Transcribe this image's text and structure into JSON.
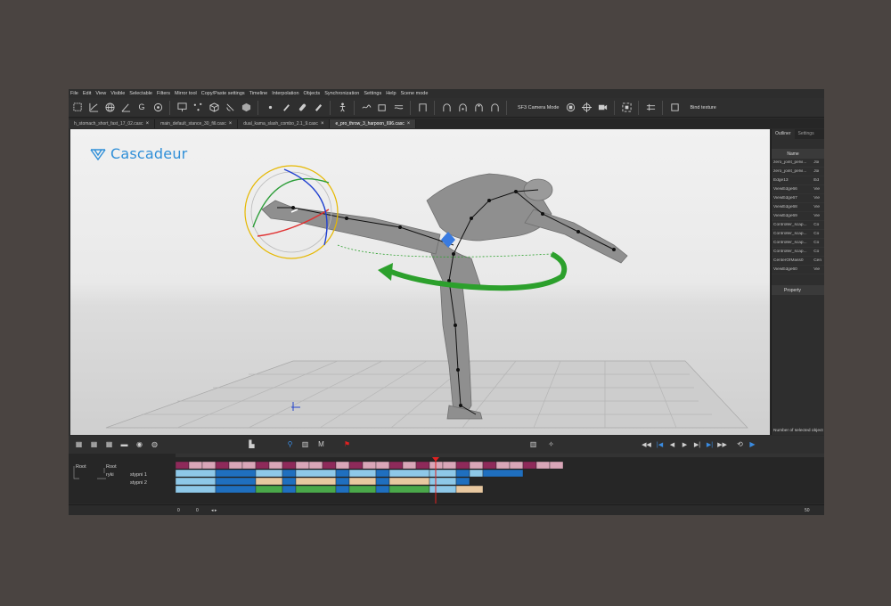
{
  "menu": [
    "File",
    "Edit",
    "View",
    "Visible",
    "Selectable",
    "Filters",
    "Mirror tool",
    "Copy/Paste settings",
    "Timeline",
    "Interpolation",
    "Objects",
    "Synchronization",
    "Settings",
    "Help",
    "Scene mode"
  ],
  "toolbar": {
    "camera_mode": "SF3 Camera Mode",
    "bind_texture": "Bind texture"
  },
  "tabs": [
    {
      "label": "h_stomach_short_fast_17_02.casc",
      "active": false
    },
    {
      "label": "main_default_stance_30_fill.casc",
      "active": false
    },
    {
      "label": "dual_kama_slash_combo_2.1_9.casc",
      "active": false
    },
    {
      "label": "e_pro_throw_3_harpoon_696.casc",
      "active": true
    }
  ],
  "logo": {
    "text": "Cascadeur",
    "color": "#2f8fd8"
  },
  "right_panel": {
    "tabs": [
      "Outliner",
      "Settings"
    ],
    "column_header": "Name",
    "rows": [
      {
        "name": "zero_joint_pelvi...",
        "type": "Joi"
      },
      {
        "name": "zero_joint_pelvi...",
        "type": "Joi"
      },
      {
        "name": "Edge13",
        "type": "Ed"
      },
      {
        "name": "ViewEdge66",
        "type": "Vie"
      },
      {
        "name": "ViewEdge67",
        "type": "Vie"
      },
      {
        "name": "ViewEdge68",
        "type": "Vie"
      },
      {
        "name": "ViewEdge69",
        "type": "Vie"
      },
      {
        "name": "Controller_scap...",
        "type": "Co"
      },
      {
        "name": "Controller_scap...",
        "type": "Co"
      },
      {
        "name": "Controller_scap...",
        "type": "Co"
      },
      {
        "name": "Controller_scap...",
        "type": "Co"
      },
      {
        "name": "CenterOfMass0",
        "type": "Cen"
      },
      {
        "name": "ViewEdge60",
        "type": "Vie"
      }
    ],
    "property_header": "Property",
    "status": "Number of selected object"
  },
  "timeline": {
    "tracks": [
      {
        "label": "Root",
        "label2": "Root"
      },
      {
        "label": "ryki",
        "label2": "stypni 1"
      },
      {
        "label": "stypni 2"
      }
    ],
    "frame_start": "0",
    "frame_cur": "0",
    "frame_end": "50",
    "colors": {
      "magenta": "#8e2a5a",
      "pink": "#d9a6b8",
      "blue": "#1f6fbf",
      "lightblue": "#8ec8e8",
      "tan": "#e8c8a0",
      "green": "#4aa84a",
      "red": "#e02020"
    }
  }
}
